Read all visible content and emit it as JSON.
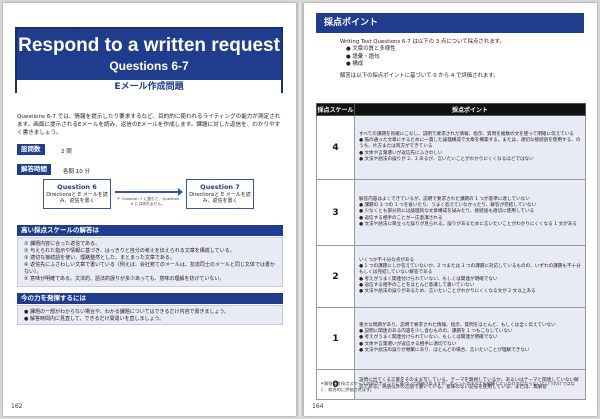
{
  "left": {
    "title": "Respond to a written request",
    "subtitle": "Questions 6-7",
    "email_label": "Eメール作成問題",
    "intro": "Questions 6-7 では、情報を提示したり要求するなど、目的的に使われるライティングの能力が測定されます。画面に提示されるEメールを読み、返信のEメールを作成します。課題に対した返信を、わかりやすく書きましょう。",
    "count_label": "設問数",
    "count_value": "2 問",
    "time_label": "解答時間",
    "time_value": "各問 10 分",
    "flow": {
      "q6_title": "Question 6",
      "q6_desc": "Directionsと E メールを読み、返信を書く",
      "note": "＊ Question 7 に進むと、Question 6 には戻れません。",
      "q7_title": "Question 7",
      "q7_desc": "Directionsと E メールを読み、返信を書く"
    },
    "high_label": "高い採点スケールの解答は",
    "high_items": [
      "① 課題内容に合った返信である。",
      "② 与えられた指示や情報に基づき、はっきりと自分の考えを伝えられる文章を構成している。",
      "③ 適切な接続語を使い、理路整然とした、まとまった文章である。",
      "④ 返信先にふさわしい文章で書いている（例えば、会社宛てのメールは、友達同士のメールと同じ文体では書かない）。",
      "⑤ 意味が明確である。文法的、語法的誤りが多少あっても、意味の理解を妨げていない。"
    ],
    "action_label": "今の力を発揮するには",
    "action_items": [
      "● 課題の一部がわからない場合や、わかる課題についてはできるだけ内容で書きましょう。",
      "● 解答時間内に見直して、できるだけ間違いを直しましょう。"
    ],
    "page_number": "162"
  },
  "right": {
    "title": "採点ポイント",
    "intro_line": "Writing Test Questions 6-7 は以下の 3 点について採点されます。",
    "criteria": [
      "● 文章の質と多様性",
      "● 語彙・語句",
      "● 構成"
    ],
    "intro_line2": "解答は以下の採点ポイントに基づいて 0 から 4 で評価されます。",
    "table_header_score": "採点スケール",
    "table_header_points": "採点ポイント",
    "rows": [
      {
        "score": "4",
        "lines": [
          "すべての課題を的確にこなし、説明で要求された情報、指示、質問を複数の文を使って明確に伝えている",
          "● 筋の通った文章にするために一貫した論理構成で文章を構築する。または、適切な接続語を使用する、のうち、片方または両方ができている",
          "● 文体や言葉遣いが返信先にふさわしい",
          "● 文法や語法の誤りが 2、3 あるが、言いたいことがわかりにくくなるほどではない"
        ]
      },
      {
        "score": "3",
        "lines": [
          "解答内容はよくできているが、説明で要求された課題の 1 つが基準に達していない",
          "● 課題の 3 つの 1 つを省いたり、うまく答えていなかったり、解答が完結していない",
          "● 少なくとも部分的には論理的な文章構成を試みたり、接続語も適切に使用している",
          "● 返信する相手のことが一応意識される",
          "● 文法や語法に目立った誤りが見られる。誤りがあるために言いたいことがわかりにくくなる 1 文がある"
        ]
      },
      {
        "score": "2",
        "lines": [
          "いくつか不十分な点がある",
          "● 1 つの課題にしか答えていないか、2 つまたは 3 つの課題に対応しているものの、いずれの課題も不十分もしくは完結していない解答である",
          "● 考えがうまく関連付けられていない、もしくは関連が明確でない",
          "● 返信する相手のことをほとんど意識して書いていない",
          "● 文法や語法の誤りがあるため、言いたいことがわかりにくくなる文が 2 文以上ある"
        ]
      },
      {
        "score": "1",
        "lines": [
          "重大な問題があり、説明で要求された情報、指示、質問をほとんど、もしくは全く伝えていない",
          "● 説明に関連のある内容を少し含むものの、課題を 1 つもこなしていない",
          "● 考えがうまく関連付けられていない、もしくは関連が明確でない",
          "● 文体や言葉遣いが返信する相手に適切でない",
          "● 文法や語法の誤りが頻繁にあり、ほとんどの場合、言いたいことが理解できない"
        ]
      },
      {
        "score": "0",
        "lines": [
          "設問に出てくる言葉をそのまま写している。テーマを無視しているか、あるいはテーマと関連していない解答である。英語以外の言語で書いている。意味のない記号を使用している、または、無解答"
        ]
      }
    ],
    "footnote": "＊解答は各採点スケールの採点ポイントに基づいて評価されますが、ポイントのすべてを網羅していなければならないというわけではなく、総合的に評価されます。",
    "page_number": "164"
  }
}
